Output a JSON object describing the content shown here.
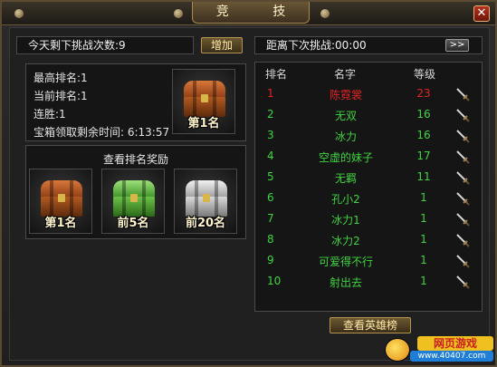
{
  "window": {
    "title": "竞 技",
    "close_symbol": "✕"
  },
  "challenges": {
    "label": "今天剩下挑战次数:9",
    "add_button": "增加"
  },
  "next_challenge": {
    "label": "距离下次挑战:00:00",
    "skip_button": ">>"
  },
  "stats": {
    "best_rank": "最高排名:1",
    "current_rank": "当前排名:1",
    "streak": "连胜:1",
    "chest_timer": "宝箱领取剩余时间: 6:13:57"
  },
  "current_chest": {
    "caption": "第1名",
    "tier": "bronze"
  },
  "rewards": {
    "title": "查看排名奖励",
    "chests": [
      {
        "caption": "第1名",
        "tier": "bronze"
      },
      {
        "caption": "前5名",
        "tier": "green"
      },
      {
        "caption": "前20名",
        "tier": "silver"
      }
    ]
  },
  "leaderboard": {
    "headers": {
      "rank": "排名",
      "name": "名字",
      "level": "等级"
    },
    "rows": [
      {
        "rank": "1",
        "name": "陈霓裳",
        "level": "23",
        "highlight": true,
        "icon": "sword-icon"
      },
      {
        "rank": "2",
        "name": "无双",
        "level": "16",
        "highlight": false,
        "icon": "sword-icon"
      },
      {
        "rank": "3",
        "name": "冰力",
        "level": "16",
        "highlight": false,
        "icon": "sword-icon"
      },
      {
        "rank": "4",
        "name": "空虚的妹子",
        "level": "17",
        "highlight": false,
        "icon": "sword-icon"
      },
      {
        "rank": "5",
        "name": "无羁",
        "level": "11",
        "highlight": false,
        "icon": "sword-icon"
      },
      {
        "rank": "6",
        "name": "孔小2",
        "level": "1",
        "highlight": false,
        "icon": "sword-icon"
      },
      {
        "rank": "7",
        "name": "冰力1",
        "level": "1",
        "highlight": false,
        "icon": "sword-icon"
      },
      {
        "rank": "8",
        "name": "冰力2",
        "level": "1",
        "highlight": false,
        "icon": "sword-icon"
      },
      {
        "rank": "9",
        "name": "可爱得不行",
        "level": "1",
        "highlight": false,
        "icon": "sword-icon"
      },
      {
        "rank": "10",
        "name": "射出去",
        "level": "1",
        "highlight": false,
        "icon": "sword-icon"
      }
    ],
    "view_button": "查看英雄榜"
  },
  "watermark": {
    "line1": "网页游戏",
    "line2": "www.40407.com"
  },
  "colors": {
    "highlight": "#e02424",
    "normal": "#3ed43e",
    "gold": "#b69552"
  }
}
